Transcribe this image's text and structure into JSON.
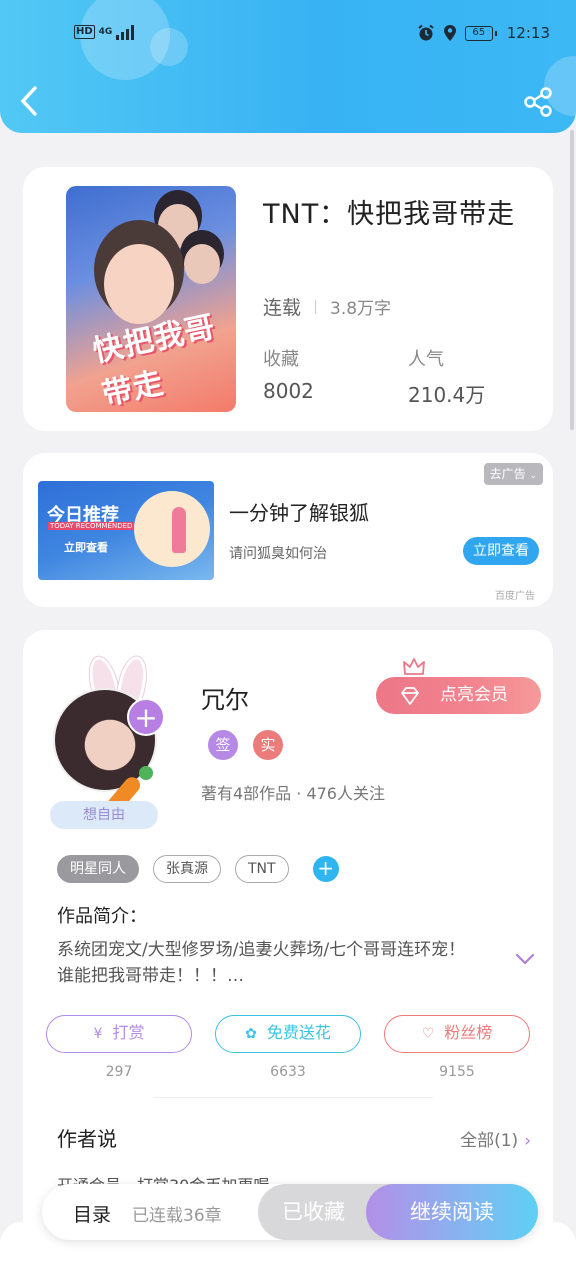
{
  "status_bar": {
    "network": "HD",
    "signal": "4G",
    "battery": "65",
    "time": "12:13"
  },
  "icons": {
    "back": "chevron-left-icon",
    "share": "share-icon",
    "alarm": "alarm-icon",
    "location": "location-icon"
  },
  "book": {
    "title": "TNT：快把我哥带走",
    "cover_text": "快把我哥带走",
    "status": "连载",
    "word_count": "3.8万字",
    "favorites_label": "收藏",
    "favorites_value": "8002",
    "popularity_label": "人气",
    "popularity_value": "210.4万"
  },
  "ad": {
    "close_label": "去广告",
    "image_title": "今日推荐",
    "image_sub": "TODAY RECOMMENDED",
    "image_button": "立即查看",
    "title": "一分钟了解银狐",
    "subtitle": "请问狐臭如何治",
    "button": "立即查看",
    "source": "百度广告"
  },
  "author": {
    "name": "冗尔",
    "mood": "想自由",
    "vip_button": "点亮会员",
    "badge_signed": "签",
    "badge_real": "实",
    "stats": "著有4部作品 · 476人关注",
    "tags": [
      "明星同人",
      "张真源",
      "TNT"
    ],
    "intro_title": "作品简介：",
    "intro_text": "系统团宠文/大型修罗场/追妻火葬场/七个哥哥连环宠！谁能把我哥带走！！！…",
    "actions": [
      {
        "label": "打赏",
        "count": "297",
        "color": "#b48be6"
      },
      {
        "label": "免费送花",
        "count": "6633",
        "color": "#3cc3e3"
      },
      {
        "label": "粉丝榜",
        "count": "9155",
        "color": "#ec7b7b"
      }
    ],
    "say_title": "作者说",
    "say_all": "全部(1)",
    "say_snippet": "开通会员，打赏30金币加更喔"
  },
  "bottom": {
    "toc": "目录",
    "toc_sub": "已连载36章",
    "fav": "已收藏",
    "read": "继续阅读"
  },
  "colors": {
    "header": "#38b2f3",
    "accent_purple": "#b77fe3",
    "vip": "#ec7787",
    "ad_button": "#2fa6ef"
  }
}
